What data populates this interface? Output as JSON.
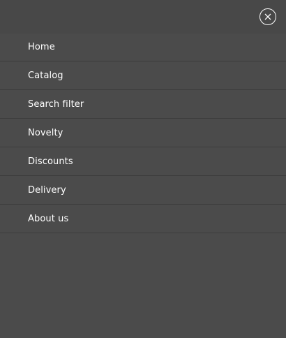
{
  "header": {
    "close_icon": "close-icon"
  },
  "menu": {
    "items": [
      {
        "label": "Home"
      },
      {
        "label": "Catalog"
      },
      {
        "label": "Search filter"
      },
      {
        "label": "Novelty"
      },
      {
        "label": "Discounts"
      },
      {
        "label": "Delivery"
      },
      {
        "label": "About us"
      }
    ]
  },
  "colors": {
    "background": "#4b4b4b",
    "header_background": "#484848",
    "divider": "#3c3c3c",
    "text": "#ffffff"
  }
}
